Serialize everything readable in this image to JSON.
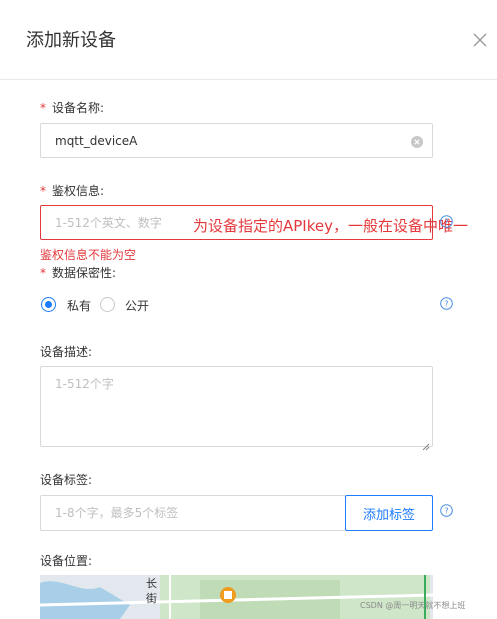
{
  "dialog": {
    "title": "添加新设备"
  },
  "fields": {
    "device_name": {
      "label": "设备名称:",
      "value": "mqtt_deviceA"
    },
    "auth_info": {
      "label": "鉴权信息:",
      "placeholder": "1-512个英文、数字",
      "error": "鉴权信息不能为空",
      "annotation": "为设备指定的APIkey，一般在设备中唯一"
    },
    "privacy": {
      "label": "数据保密性:",
      "options": [
        "私有",
        "公开"
      ],
      "selected": "私有"
    },
    "description": {
      "label": "设备描述:",
      "placeholder": "1-512个字"
    },
    "tags": {
      "label": "设备标签:",
      "placeholder": "1-8个字，最多5个标签",
      "add_button": "添加标签"
    },
    "location": {
      "label": "设备位置:",
      "map_text": [
        "长",
        "街"
      ]
    }
  },
  "watermark": "CSDN @周一明天就不想上班",
  "colors": {
    "required": "#e4393c",
    "accent": "#1e7cff",
    "error": "#e4393c"
  },
  "icons": {
    "close": "close-icon",
    "clear": "clear-icon",
    "help": "help-icon"
  }
}
